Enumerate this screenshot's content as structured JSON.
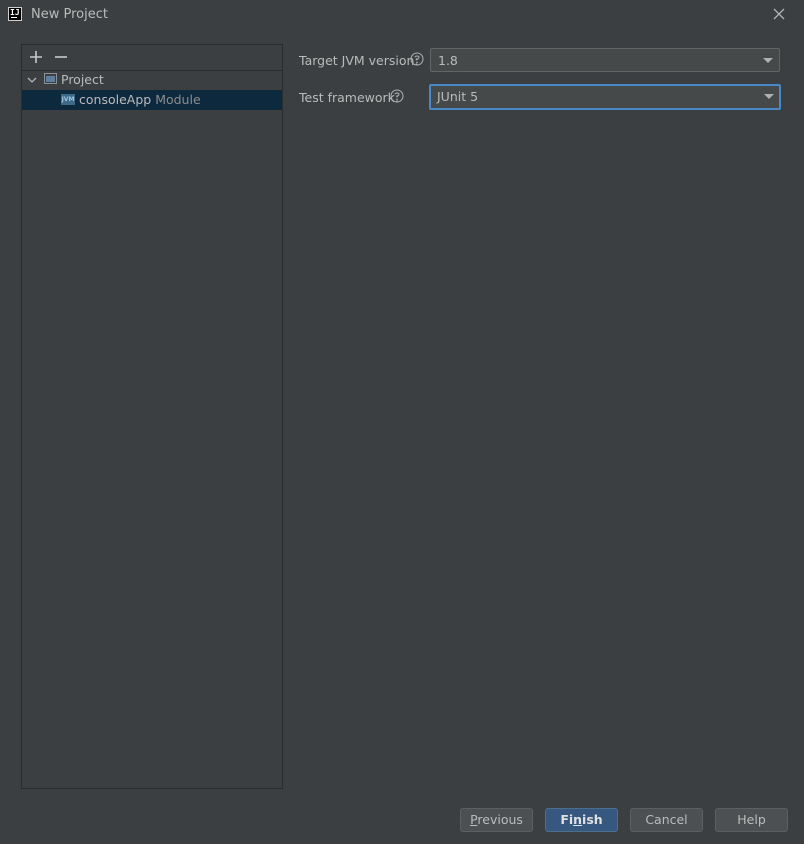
{
  "window": {
    "title": "New Project",
    "app_icon_text": "IJ"
  },
  "sidebar": {
    "add_symbol": "+",
    "remove_symbol": "−",
    "tree": {
      "project_label": "Project",
      "module_badge": "JVM",
      "module_name": "consoleApp",
      "module_type": "Module"
    }
  },
  "form": {
    "jvm_label": "Target JVM version:",
    "jvm_value": "1.8",
    "test_label": "Test framework:",
    "test_value": "JUnit 5"
  },
  "buttons": {
    "previous_pre": "",
    "previous_mnemonic": "P",
    "previous_post": "revious",
    "finish_pre": "Fi",
    "finish_mnemonic": "n",
    "finish_post": "ish",
    "cancel": "Cancel",
    "help": "Help"
  },
  "colors": {
    "background": "#3c3f41",
    "selection": "#0d293e",
    "focus_border": "#4a88c7",
    "primary_button": "#365880"
  }
}
